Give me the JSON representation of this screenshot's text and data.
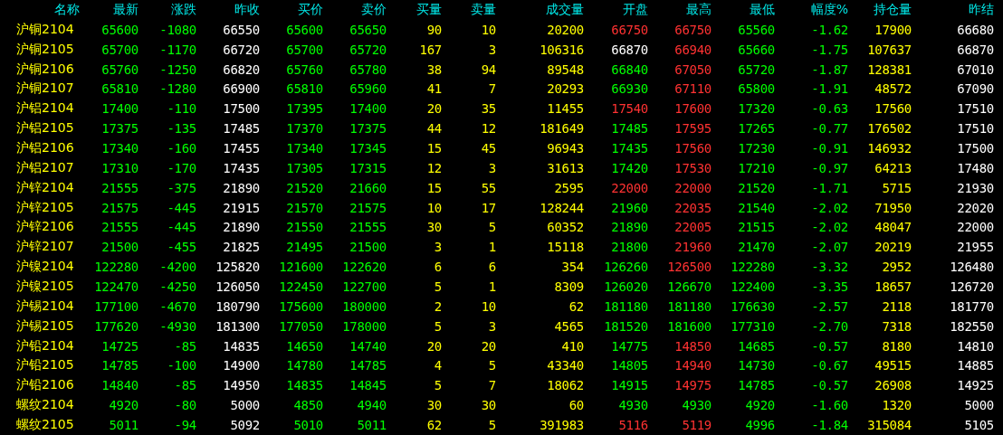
{
  "columns": [
    "名称",
    "最新",
    "涨跌",
    "昨收",
    "买价",
    "卖价",
    "买量",
    "卖量",
    "成交量",
    "开盘",
    "最高",
    "最低",
    "幅度%",
    "持仓量",
    "昨结"
  ],
  "rows": [
    {
      "name": "沪铜2104",
      "last": "65600",
      "change": "-1080",
      "prev_close": "66550",
      "bid": "65600",
      "ask": "65650",
      "bid_vol": "90",
      "ask_vol": "10",
      "volume": "20200",
      "open": {
        "text": "66750",
        "color": "#ff3232"
      },
      "high": {
        "text": "66750",
        "color": "#ff3232"
      },
      "low": "65560",
      "range_pct": "-1.62",
      "open_interest": "17900",
      "prev_settle": "66680"
    },
    {
      "name": "沪铜2105",
      "last": "65700",
      "change": "-1170",
      "prev_close": "66720",
      "bid": "65700",
      "ask": "65720",
      "bid_vol": "167",
      "ask_vol": "3",
      "volume": "106316",
      "open": {
        "text": "66870",
        "color": "#ffffff"
      },
      "high": {
        "text": "66940",
        "color": "#ff3232"
      },
      "low": "65660",
      "range_pct": "-1.75",
      "open_interest": "107637",
      "prev_settle": "66870"
    },
    {
      "name": "沪铜2106",
      "last": "65760",
      "change": "-1250",
      "prev_close": "66820",
      "bid": "65760",
      "ask": "65780",
      "bid_vol": "38",
      "ask_vol": "94",
      "volume": "89548",
      "open": {
        "text": "66840",
        "color": "#00ff00"
      },
      "high": {
        "text": "67050",
        "color": "#ff3232"
      },
      "low": "65720",
      "range_pct": "-1.87",
      "open_interest": "128381",
      "prev_settle": "67010"
    },
    {
      "name": "沪铜2107",
      "last": "65810",
      "change": "-1280",
      "prev_close": "66900",
      "bid": "65810",
      "ask": "65960",
      "bid_vol": "41",
      "ask_vol": "7",
      "volume": "20293",
      "open": {
        "text": "66930",
        "color": "#00ff00"
      },
      "high": {
        "text": "67110",
        "color": "#ff3232"
      },
      "low": "65800",
      "range_pct": "-1.91",
      "open_interest": "48572",
      "prev_settle": "67090"
    },
    {
      "name": "沪铝2104",
      "last": "17400",
      "change": "-110",
      "prev_close": "17500",
      "bid": "17395",
      "ask": "17400",
      "bid_vol": "20",
      "ask_vol": "35",
      "volume": "11455",
      "open": {
        "text": "17540",
        "color": "#ff3232"
      },
      "high": {
        "text": "17600",
        "color": "#ff3232"
      },
      "low": "17320",
      "range_pct": "-0.63",
      "open_interest": "17560",
      "prev_settle": "17510"
    },
    {
      "name": "沪铝2105",
      "last": "17375",
      "change": "-135",
      "prev_close": "17485",
      "bid": "17370",
      "ask": "17375",
      "bid_vol": "44",
      "ask_vol": "12",
      "volume": "181649",
      "open": {
        "text": "17485",
        "color": "#00ff00"
      },
      "high": {
        "text": "17595",
        "color": "#ff3232"
      },
      "low": "17265",
      "range_pct": "-0.77",
      "open_interest": "176502",
      "prev_settle": "17510"
    },
    {
      "name": "沪铝2106",
      "last": "17340",
      "change": "-160",
      "prev_close": "17455",
      "bid": "17340",
      "ask": "17345",
      "bid_vol": "15",
      "ask_vol": "45",
      "volume": "96943",
      "open": {
        "text": "17435",
        "color": "#00ff00"
      },
      "high": {
        "text": "17560",
        "color": "#ff3232"
      },
      "low": "17230",
      "range_pct": "-0.91",
      "open_interest": "146932",
      "prev_settle": "17500"
    },
    {
      "name": "沪铝2107",
      "last": "17310",
      "change": "-170",
      "prev_close": "17435",
      "bid": "17305",
      "ask": "17315",
      "bid_vol": "12",
      "ask_vol": "3",
      "volume": "31613",
      "open": {
        "text": "17420",
        "color": "#00ff00"
      },
      "high": {
        "text": "17530",
        "color": "#ff3232"
      },
      "low": "17210",
      "range_pct": "-0.97",
      "open_interest": "64213",
      "prev_settle": "17480"
    },
    {
      "name": "沪锌2104",
      "last": "21555",
      "change": "-375",
      "prev_close": "21890",
      "bid": "21520",
      "ask": "21660",
      "bid_vol": "15",
      "ask_vol": "55",
      "volume": "2595",
      "open": {
        "text": "22000",
        "color": "#ff3232"
      },
      "high": {
        "text": "22000",
        "color": "#ff3232"
      },
      "low": "21520",
      "range_pct": "-1.71",
      "open_interest": "5715",
      "prev_settle": "21930"
    },
    {
      "name": "沪锌2105",
      "last": "21575",
      "change": "-445",
      "prev_close": "21915",
      "bid": "21570",
      "ask": "21575",
      "bid_vol": "10",
      "ask_vol": "17",
      "volume": "128244",
      "open": {
        "text": "21960",
        "color": "#00ff00"
      },
      "high": {
        "text": "22035",
        "color": "#ff3232"
      },
      "low": "21540",
      "range_pct": "-2.02",
      "open_interest": "71950",
      "prev_settle": "22020"
    },
    {
      "name": "沪锌2106",
      "last": "21555",
      "change": "-445",
      "prev_close": "21890",
      "bid": "21550",
      "ask": "21555",
      "bid_vol": "30",
      "ask_vol": "5",
      "volume": "60352",
      "open": {
        "text": "21890",
        "color": "#00ff00"
      },
      "high": {
        "text": "22005",
        "color": "#ff3232"
      },
      "low": "21515",
      "range_pct": "-2.02",
      "open_interest": "48047",
      "prev_settle": "22000"
    },
    {
      "name": "沪锌2107",
      "last": "21500",
      "change": "-455",
      "prev_close": "21825",
      "bid": "21495",
      "ask": "21500",
      "bid_vol": "3",
      "ask_vol": "1",
      "volume": "15118",
      "open": {
        "text": "21800",
        "color": "#00ff00"
      },
      "high": {
        "text": "21960",
        "color": "#ff3232"
      },
      "low": "21470",
      "range_pct": "-2.07",
      "open_interest": "20219",
      "prev_settle": "21955"
    },
    {
      "name": "沪镍2104",
      "last": "122280",
      "change": "-4200",
      "prev_close": "125820",
      "bid": "121600",
      "ask": "122620",
      "bid_vol": "6",
      "ask_vol": "6",
      "volume": "354",
      "open": {
        "text": "126260",
        "color": "#00ff00"
      },
      "high": {
        "text": "126500",
        "color": "#ff3232"
      },
      "low": "122280",
      "range_pct": "-3.32",
      "open_interest": "2952",
      "prev_settle": "126480"
    },
    {
      "name": "沪镍2105",
      "last": "122470",
      "change": "-4250",
      "prev_close": "126050",
      "bid": "122450",
      "ask": "122700",
      "bid_vol": "5",
      "ask_vol": "1",
      "volume": "8309",
      "open": {
        "text": "126020",
        "color": "#00ff00"
      },
      "high": {
        "text": "126670",
        "color": "#00ff00"
      },
      "low": "122400",
      "range_pct": "-3.35",
      "open_interest": "18657",
      "prev_settle": "126720"
    },
    {
      "name": "沪锡2104",
      "last": "177100",
      "change": "-4670",
      "prev_close": "180790",
      "bid": "175600",
      "ask": "180000",
      "bid_vol": "2",
      "ask_vol": "10",
      "volume": "62",
      "open": {
        "text": "181180",
        "color": "#00ff00"
      },
      "high": {
        "text": "181180",
        "color": "#00ff00"
      },
      "low": "176630",
      "range_pct": "-2.57",
      "open_interest": "2118",
      "prev_settle": "181770"
    },
    {
      "name": "沪锡2105",
      "last": "177620",
      "change": "-4930",
      "prev_close": "181300",
      "bid": "177050",
      "ask": "178000",
      "bid_vol": "5",
      "ask_vol": "3",
      "volume": "4565",
      "open": {
        "text": "181520",
        "color": "#00ff00"
      },
      "high": {
        "text": "181600",
        "color": "#00ff00"
      },
      "low": "177310",
      "range_pct": "-2.70",
      "open_interest": "7318",
      "prev_settle": "182550"
    },
    {
      "name": "沪铅2104",
      "last": "14725",
      "change": "-85",
      "prev_close": "14835",
      "bid": "14650",
      "ask": "14740",
      "bid_vol": "20",
      "ask_vol": "20",
      "volume": "410",
      "open": {
        "text": "14775",
        "color": "#00ff00"
      },
      "high": {
        "text": "14850",
        "color": "#ff3232"
      },
      "low": "14685",
      "range_pct": "-0.57",
      "open_interest": "8180",
      "prev_settle": "14810"
    },
    {
      "name": "沪铅2105",
      "last": "14785",
      "change": "-100",
      "prev_close": "14900",
      "bid": "14780",
      "ask": "14785",
      "bid_vol": "4",
      "ask_vol": "5",
      "volume": "43340",
      "open": {
        "text": "14805",
        "color": "#00ff00"
      },
      "high": {
        "text": "14940",
        "color": "#ff3232"
      },
      "low": "14730",
      "range_pct": "-0.67",
      "open_interest": "49515",
      "prev_settle": "14885"
    },
    {
      "name": "沪铅2106",
      "last": "14840",
      "change": "-85",
      "prev_close": "14950",
      "bid": "14835",
      "ask": "14845",
      "bid_vol": "5",
      "ask_vol": "7",
      "volume": "18062",
      "open": {
        "text": "14915",
        "color": "#00ff00"
      },
      "high": {
        "text": "14975",
        "color": "#ff3232"
      },
      "low": "14785",
      "range_pct": "-0.57",
      "open_interest": "26908",
      "prev_settle": "14925"
    },
    {
      "name": "螺纹2104",
      "last": "4920",
      "change": "-80",
      "prev_close": "5000",
      "bid": "4850",
      "ask": "4940",
      "bid_vol": "30",
      "ask_vol": "30",
      "volume": "60",
      "open": {
        "text": "4930",
        "color": "#00ff00"
      },
      "high": {
        "text": "4930",
        "color": "#00ff00"
      },
      "low": "4920",
      "range_pct": "-1.60",
      "open_interest": "1320",
      "prev_settle": "5000"
    },
    {
      "name": "螺纹2105",
      "last": "5011",
      "change": "-94",
      "prev_close": "5092",
      "bid": "5010",
      "ask": "5011",
      "bid_vol": "62",
      "ask_vol": "5",
      "volume": "391983",
      "open": {
        "text": "5116",
        "color": "#ff3232"
      },
      "high": {
        "text": "5119",
        "color": "#ff3232"
      },
      "low": "4996",
      "range_pct": "-1.84",
      "open_interest": "315084",
      "prev_settle": "5105"
    }
  ]
}
